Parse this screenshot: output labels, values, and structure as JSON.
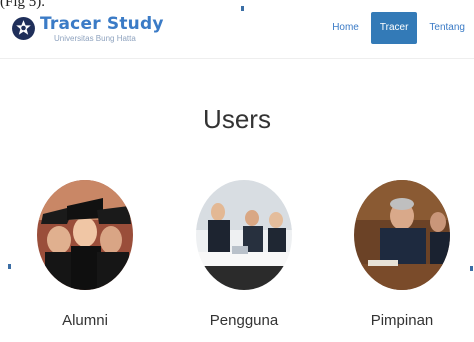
{
  "caption": "(Fig 5).",
  "brand": {
    "title": "Tracer Study",
    "subtitle": "Universitas Bung Hatta"
  },
  "nav": [
    {
      "label": "Home",
      "active": false
    },
    {
      "label": "Tracer",
      "active": true
    },
    {
      "label": "Tentang",
      "active": false
    }
  ],
  "section": {
    "title": "Users"
  },
  "users": [
    {
      "label": "Alumni",
      "image": "graduates-photo"
    },
    {
      "label": "Pengguna",
      "image": "office-meeting-photo"
    },
    {
      "label": "Pimpinan",
      "image": "executives-photo"
    }
  ],
  "colors": {
    "accent": "#337ab7",
    "brand_text": "#3b7bc6"
  }
}
